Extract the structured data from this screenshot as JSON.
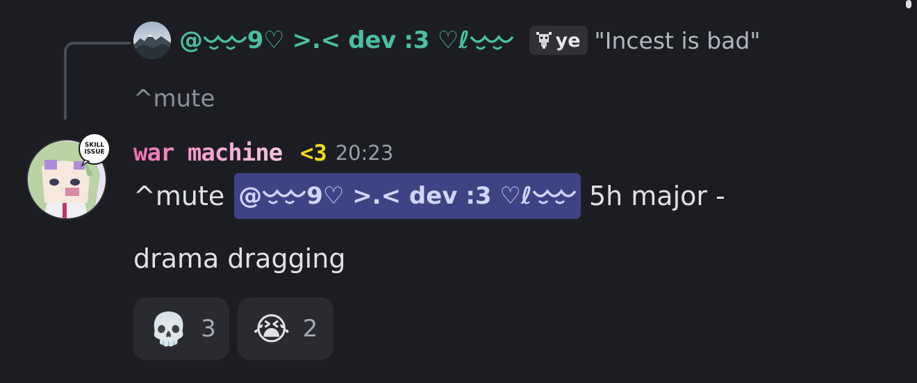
{
  "reply": {
    "mention_prefix": "@",
    "name_core": "9♡ >.< dev :3 ♡ℓ",
    "tag_icon": "goat-icon",
    "tag_text": "ye",
    "content": "\"Incest is bad\""
  },
  "mute_line": "^mute",
  "message": {
    "username": "war machine",
    "name_tag": "<3",
    "timestamp": "20:23",
    "avatar_badge": "SKILL ISSUE",
    "text_before": "^mute",
    "mention": "@‿‿9♡ >.< dev :3 ♡ℓ‿‿",
    "mention_prefix": "@",
    "mention_core": "9♡ >.< dev :3 ♡ℓ",
    "text_after": "5h major -",
    "line2": "drama dragging"
  },
  "reactions": [
    {
      "emoji": "💀",
      "count": "3",
      "icon": "skull-emoji"
    },
    {
      "emoji": "😭",
      "count": "2",
      "icon": "loudly-crying-emoji"
    }
  ],
  "colors": {
    "background": "#1c1d22",
    "reply_name": "#4bbfa0",
    "mention_bg": "#3e4384",
    "mention_text": "#d1d6ff",
    "username_pink": "#ee6fb1",
    "heart_yellow": "#f2dc1a"
  }
}
